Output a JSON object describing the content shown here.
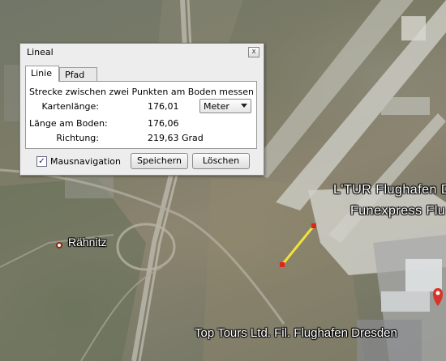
{
  "dialog": {
    "title": "Lineal",
    "close_symbol": "x",
    "tabs": [
      {
        "label": "Linie",
        "active": true
      },
      {
        "label": "Pfad",
        "active": false
      }
    ],
    "description": "Strecke zwischen zwei Punkten am Boden messen",
    "map_length": {
      "label": "Kartenlänge:",
      "value": "176,01",
      "unit": "Meter"
    },
    "ground_length": {
      "label": "Länge am Boden:",
      "value": "176,06"
    },
    "heading": {
      "label": "Richtung:",
      "value": "219,63 Grad"
    },
    "mouse_navigation": {
      "label": "Mausnavigation",
      "checked": true
    },
    "buttons": {
      "save": "Speichern",
      "clear": "Löschen"
    }
  },
  "map": {
    "labels": {
      "raehnitz": "Rähnitz",
      "ltur": "L'TUR Flughafen D",
      "funexpress": "Funexpress Flu",
      "toptours": "Top Tours Ltd. Fil. Flughafen Dresden"
    },
    "measure_line_color": "#f2e23a",
    "measure_point_color": "#e0231c"
  }
}
